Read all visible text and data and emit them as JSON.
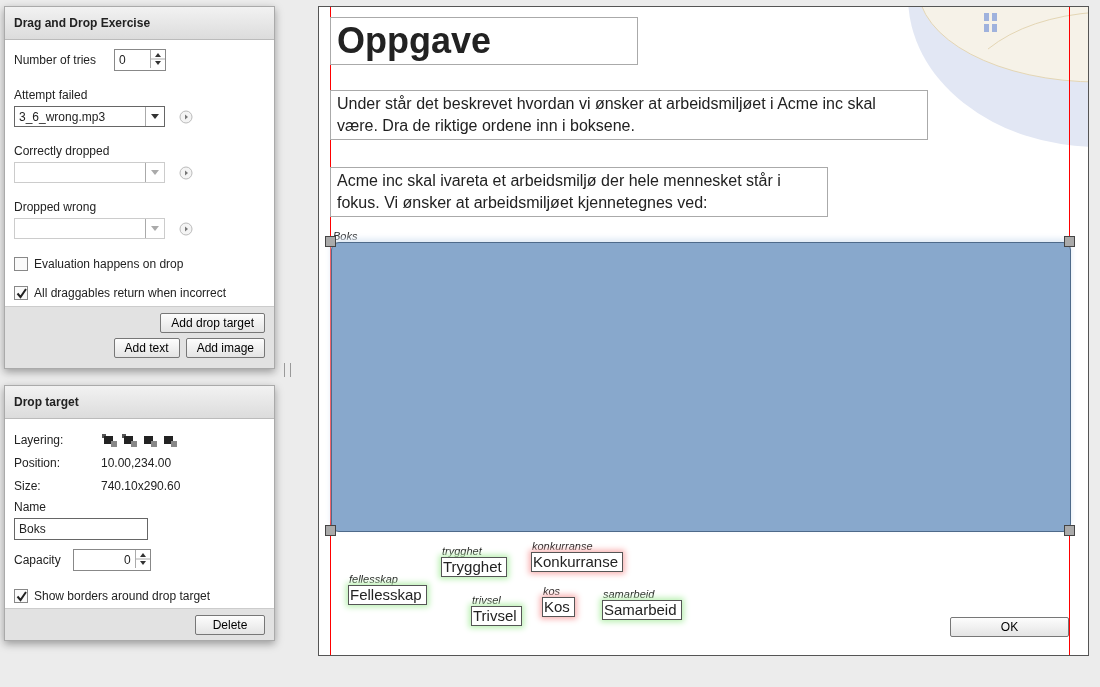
{
  "exercise_panel": {
    "title": "Drag and Drop Exercise",
    "tries": {
      "label": "Number of tries",
      "value": "0"
    },
    "sounds": [
      {
        "label": "Attempt failed",
        "value": "3_6_wrong.mp3",
        "disabled": false
      },
      {
        "label": "Correctly dropped",
        "disabled": true
      },
      {
        "label": "Dropped wrong",
        "disabled": true
      }
    ],
    "options": [
      {
        "label": "Evaluation happens on drop",
        "checked": false
      },
      {
        "label": "All draggables return when incorrect",
        "checked": true
      }
    ],
    "buttons": [
      "Add drop target",
      "Add text",
      "Add image"
    ]
  },
  "target_panel": {
    "title": "Drop target",
    "props": [
      {
        "label": "Layering:",
        "kind": "icons"
      },
      {
        "label": "Position:",
        "kind": "text",
        "value": "10.00,234.00"
      },
      {
        "label": "Size:",
        "kind": "text",
        "value": "740.10x290.60"
      }
    ],
    "name": {
      "label": "Name",
      "value": "Boks"
    },
    "capacity": {
      "label": "Capacity",
      "value": "0"
    },
    "show_borders": {
      "label": "Show borders around drop target",
      "checked": true
    },
    "delete": "Delete"
  },
  "canvas": {
    "title": "Oppgave",
    "paragraphs": [
      "Under står det beskrevet hvordan vi ønsker at arbeidsmiljøet i Acme inc skal være. Dra de riktige ordene inn i boksene.",
      "Acme inc skal ivareta et arbeidsmiljø der hele mennesket står i fokus. Vi ønsker at arbeidsmiljøet kjennetegnes ved:"
    ],
    "drop_target": {
      "label": "Boks"
    },
    "draggables": [
      {
        "name": "trygghet",
        "text": "Trygghet",
        "correct": true
      },
      {
        "name": "konkurranse",
        "text": "Konkurranse",
        "correct": false
      },
      {
        "name": "fellesskap",
        "text": "Fellesskap",
        "correct": true
      },
      {
        "name": "trivsel",
        "text": "Trivsel",
        "correct": true
      },
      {
        "name": "kos",
        "text": "Kos",
        "correct": false
      },
      {
        "name": "samarbeid",
        "text": "Samarbeid",
        "correct": true
      }
    ],
    "ok": "OK"
  }
}
